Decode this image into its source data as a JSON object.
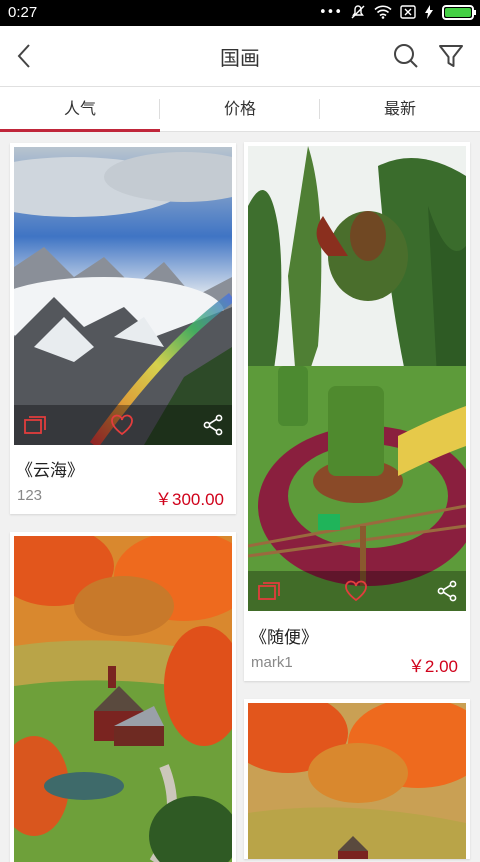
{
  "status_bar": {
    "time": "0:27",
    "dots": "•••",
    "icons": [
      "mute-icon",
      "wifi-icon",
      "sim-icon",
      "charging-icon",
      "battery-icon"
    ]
  },
  "appbar": {
    "title": "国画"
  },
  "tabs": [
    {
      "label": "人气",
      "active": true
    },
    {
      "label": "价格"
    },
    {
      "label": "最新"
    }
  ],
  "items": [
    {
      "name": "《云海》",
      "author": "123",
      "price": "￥300.00"
    },
    {
      "name": "《随便》",
      "author": "mark1",
      "price": "￥2.00"
    },
    {
      "name": "",
      "author": "",
      "price": ""
    },
    {
      "name": "",
      "author": "",
      "price": ""
    }
  ],
  "colors": {
    "accent": "#c0263a",
    "price": "#d0021b",
    "icon_red": "#e23d3d"
  }
}
